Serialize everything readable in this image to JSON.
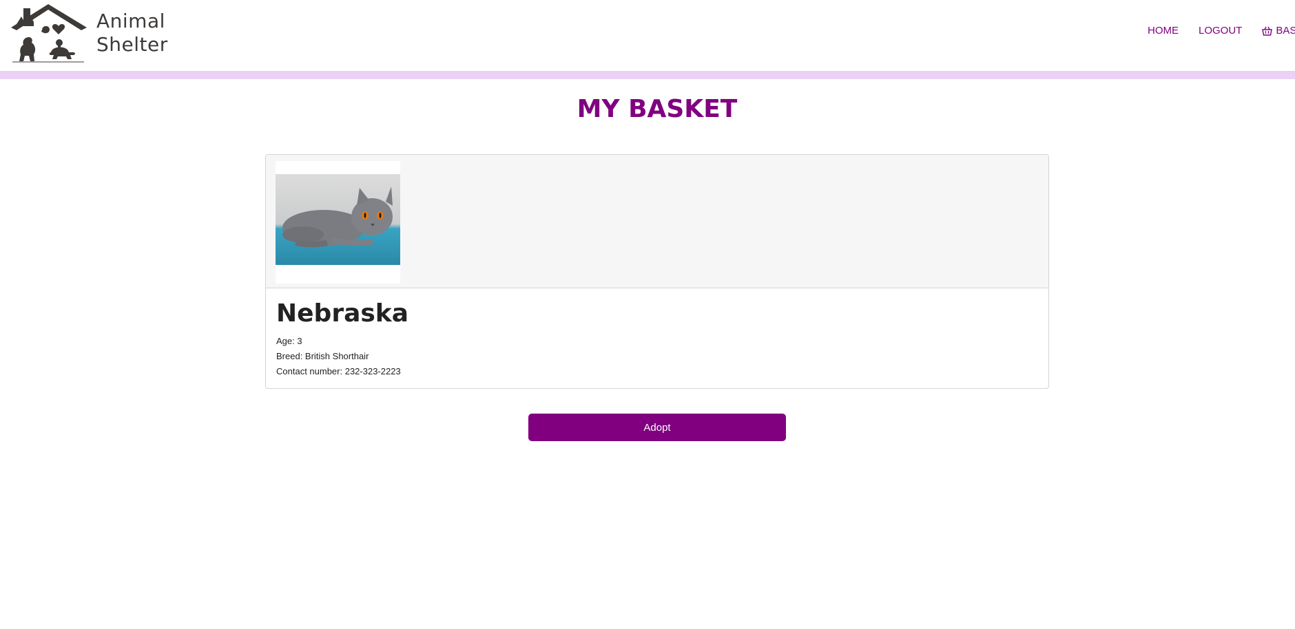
{
  "brand": {
    "line1": "Animal",
    "line2": "Shelter",
    "icon": "house-pets-logo-icon"
  },
  "nav": {
    "home": "HOME",
    "logout": "LOGOUT",
    "basket": "BASKE",
    "basket_icon": "basket-icon"
  },
  "colors": {
    "accent": "#800080",
    "header_bar": "#ebd1f5",
    "logo": "#3d3a38"
  },
  "page": {
    "title": "MY BASKET"
  },
  "basket_item": {
    "name": "Nebraska",
    "age": "Age: 3",
    "breed": "Breed: British Shorthair",
    "contact": "Contact number: 232-323-2223",
    "photo_icon": "cat-photo"
  },
  "actions": {
    "adopt_label": "Adopt"
  }
}
